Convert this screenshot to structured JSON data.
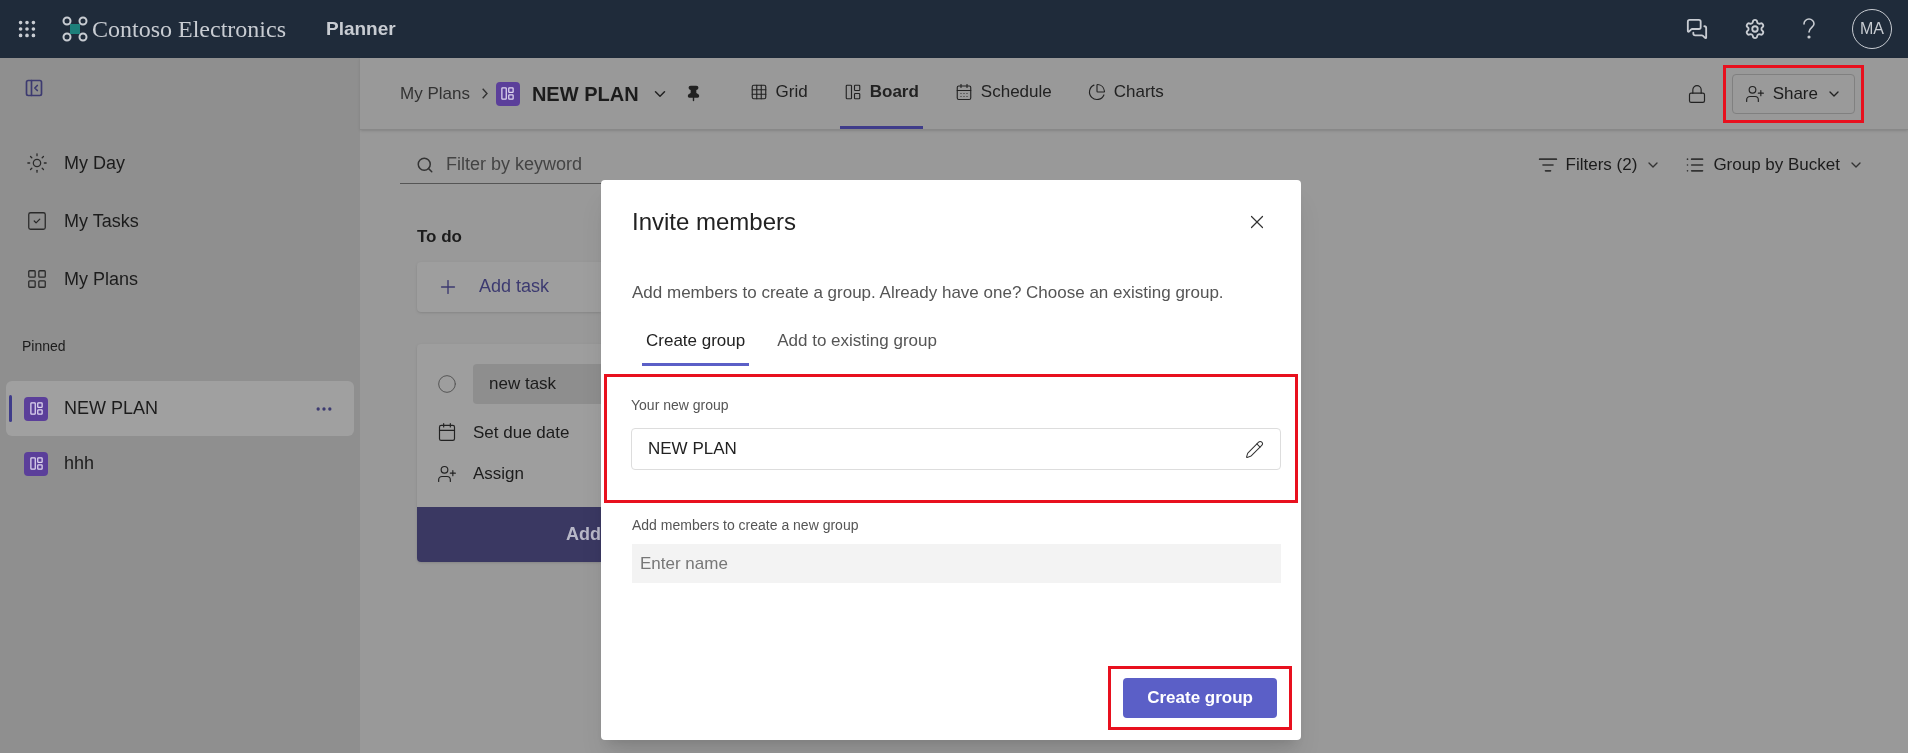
{
  "app_bar": {
    "brand": "Contoso Electronics",
    "app_name": "Planner",
    "avatar_initials": "MA"
  },
  "sidebar": {
    "nav": [
      {
        "label": "My Day",
        "kind": "sun",
        "selected": false
      },
      {
        "label": "My Tasks",
        "kind": "tasks",
        "selected": false
      },
      {
        "label": "My Plans",
        "kind": "plans",
        "selected": false
      }
    ],
    "section_label": "Pinned",
    "pinned": [
      {
        "label": "NEW PLAN",
        "selected": true
      },
      {
        "label": "hhh",
        "selected": false
      }
    ]
  },
  "header": {
    "breadcrumb": "My Plans",
    "plan_name": "NEW PLAN",
    "views": [
      {
        "label": "Grid",
        "kind": "grid",
        "selected": false
      },
      {
        "label": "Board",
        "kind": "board",
        "selected": true
      },
      {
        "label": "Schedule",
        "kind": "schedule",
        "selected": false
      },
      {
        "label": "Charts",
        "kind": "charts",
        "selected": false
      }
    ],
    "share": {
      "label": "Share",
      "highlighted": true
    }
  },
  "toolbar": {
    "search": {
      "placeholder": "Filter by keyword"
    },
    "filters": "Filters (2)",
    "group_by": "Group by Bucket"
  },
  "bucket": {
    "title": "To do",
    "add_task": "Add task",
    "draft": {
      "value": "new task",
      "due": "Set due date",
      "assign": "Assign",
      "submit": "Add"
    }
  },
  "dialog": {
    "title": "Invite members",
    "description": "Add members to create a group. Already have one? Choose an existing group.",
    "tabs": [
      {
        "label": "Create group",
        "selected": true
      },
      {
        "label": "Add to existing group",
        "selected": false
      }
    ],
    "group_section": {
      "label": "Your new group",
      "value": "NEW PLAN",
      "highlighted": true
    },
    "members": {
      "label": "Add members to create a new group",
      "placeholder": "Enter name"
    },
    "primary": {
      "label": "Create group",
      "highlighted": true
    }
  }
}
